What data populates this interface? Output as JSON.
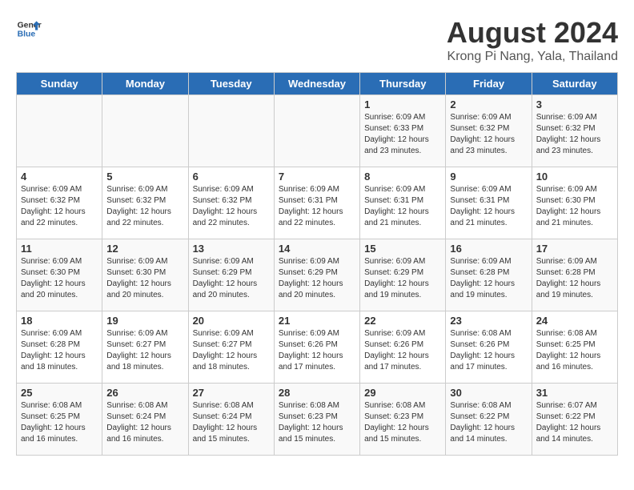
{
  "header": {
    "logo_line1": "General",
    "logo_line2": "Blue",
    "title": "August 2024",
    "subtitle": "Krong Pi Nang, Yala, Thailand"
  },
  "days_of_week": [
    "Sunday",
    "Monday",
    "Tuesday",
    "Wednesday",
    "Thursday",
    "Friday",
    "Saturday"
  ],
  "weeks": [
    [
      {
        "day": "",
        "info": ""
      },
      {
        "day": "",
        "info": ""
      },
      {
        "day": "",
        "info": ""
      },
      {
        "day": "",
        "info": ""
      },
      {
        "day": "1",
        "info": "Sunrise: 6:09 AM\nSunset: 6:33 PM\nDaylight: 12 hours\nand 23 minutes."
      },
      {
        "day": "2",
        "info": "Sunrise: 6:09 AM\nSunset: 6:32 PM\nDaylight: 12 hours\nand 23 minutes."
      },
      {
        "day": "3",
        "info": "Sunrise: 6:09 AM\nSunset: 6:32 PM\nDaylight: 12 hours\nand 23 minutes."
      }
    ],
    [
      {
        "day": "4",
        "info": "Sunrise: 6:09 AM\nSunset: 6:32 PM\nDaylight: 12 hours\nand 22 minutes."
      },
      {
        "day": "5",
        "info": "Sunrise: 6:09 AM\nSunset: 6:32 PM\nDaylight: 12 hours\nand 22 minutes."
      },
      {
        "day": "6",
        "info": "Sunrise: 6:09 AM\nSunset: 6:32 PM\nDaylight: 12 hours\nand 22 minutes."
      },
      {
        "day": "7",
        "info": "Sunrise: 6:09 AM\nSunset: 6:31 PM\nDaylight: 12 hours\nand 22 minutes."
      },
      {
        "day": "8",
        "info": "Sunrise: 6:09 AM\nSunset: 6:31 PM\nDaylight: 12 hours\nand 21 minutes."
      },
      {
        "day": "9",
        "info": "Sunrise: 6:09 AM\nSunset: 6:31 PM\nDaylight: 12 hours\nand 21 minutes."
      },
      {
        "day": "10",
        "info": "Sunrise: 6:09 AM\nSunset: 6:30 PM\nDaylight: 12 hours\nand 21 minutes."
      }
    ],
    [
      {
        "day": "11",
        "info": "Sunrise: 6:09 AM\nSunset: 6:30 PM\nDaylight: 12 hours\nand 20 minutes."
      },
      {
        "day": "12",
        "info": "Sunrise: 6:09 AM\nSunset: 6:30 PM\nDaylight: 12 hours\nand 20 minutes."
      },
      {
        "day": "13",
        "info": "Sunrise: 6:09 AM\nSunset: 6:29 PM\nDaylight: 12 hours\nand 20 minutes."
      },
      {
        "day": "14",
        "info": "Sunrise: 6:09 AM\nSunset: 6:29 PM\nDaylight: 12 hours\nand 20 minutes."
      },
      {
        "day": "15",
        "info": "Sunrise: 6:09 AM\nSunset: 6:29 PM\nDaylight: 12 hours\nand 19 minutes."
      },
      {
        "day": "16",
        "info": "Sunrise: 6:09 AM\nSunset: 6:28 PM\nDaylight: 12 hours\nand 19 minutes."
      },
      {
        "day": "17",
        "info": "Sunrise: 6:09 AM\nSunset: 6:28 PM\nDaylight: 12 hours\nand 19 minutes."
      }
    ],
    [
      {
        "day": "18",
        "info": "Sunrise: 6:09 AM\nSunset: 6:28 PM\nDaylight: 12 hours\nand 18 minutes."
      },
      {
        "day": "19",
        "info": "Sunrise: 6:09 AM\nSunset: 6:27 PM\nDaylight: 12 hours\nand 18 minutes."
      },
      {
        "day": "20",
        "info": "Sunrise: 6:09 AM\nSunset: 6:27 PM\nDaylight: 12 hours\nand 18 minutes."
      },
      {
        "day": "21",
        "info": "Sunrise: 6:09 AM\nSunset: 6:26 PM\nDaylight: 12 hours\nand 17 minutes."
      },
      {
        "day": "22",
        "info": "Sunrise: 6:09 AM\nSunset: 6:26 PM\nDaylight: 12 hours\nand 17 minutes."
      },
      {
        "day": "23",
        "info": "Sunrise: 6:08 AM\nSunset: 6:26 PM\nDaylight: 12 hours\nand 17 minutes."
      },
      {
        "day": "24",
        "info": "Sunrise: 6:08 AM\nSunset: 6:25 PM\nDaylight: 12 hours\nand 16 minutes."
      }
    ],
    [
      {
        "day": "25",
        "info": "Sunrise: 6:08 AM\nSunset: 6:25 PM\nDaylight: 12 hours\nand 16 minutes."
      },
      {
        "day": "26",
        "info": "Sunrise: 6:08 AM\nSunset: 6:24 PM\nDaylight: 12 hours\nand 16 minutes."
      },
      {
        "day": "27",
        "info": "Sunrise: 6:08 AM\nSunset: 6:24 PM\nDaylight: 12 hours\nand 15 minutes."
      },
      {
        "day": "28",
        "info": "Sunrise: 6:08 AM\nSunset: 6:23 PM\nDaylight: 12 hours\nand 15 minutes."
      },
      {
        "day": "29",
        "info": "Sunrise: 6:08 AM\nSunset: 6:23 PM\nDaylight: 12 hours\nand 15 minutes."
      },
      {
        "day": "30",
        "info": "Sunrise: 6:08 AM\nSunset: 6:22 PM\nDaylight: 12 hours\nand 14 minutes."
      },
      {
        "day": "31",
        "info": "Sunrise: 6:07 AM\nSunset: 6:22 PM\nDaylight: 12 hours\nand 14 minutes."
      }
    ]
  ]
}
